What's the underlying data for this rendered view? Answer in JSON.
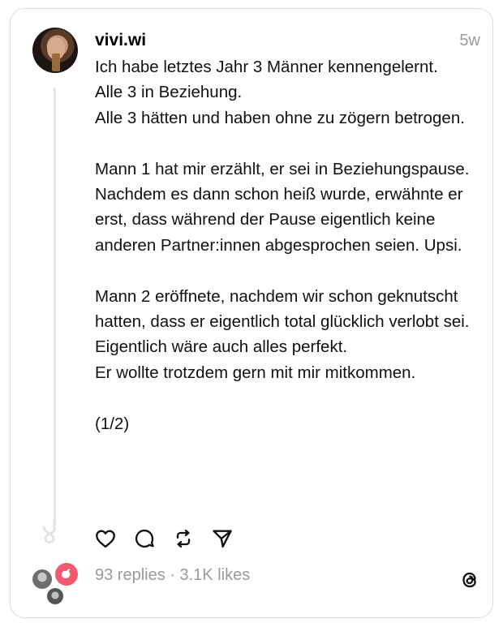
{
  "post": {
    "username": "vivi.wi",
    "time": "5w",
    "text": "Ich habe letztes Jahr 3 Männer kennengelernt.\nAlle 3 in Beziehung.\nAlle 3 hätten und haben ohne zu zögern betrogen.\n\nMann 1 hat mir erzählt, er sei in Beziehungspause. Nachdem es dann schon heiß wurde, erwähnte er erst, dass während der Pause eigentlich keine anderen Partner:innen abgesprochen seien. Upsi.\n\nMann 2 eröffnete, nachdem wir schon geknutscht hatten, dass er eigentlich total glücklich verlobt sei. Eigentlich wäre auch alles perfekt.\nEr wollte trotzdem gern mit mir mitkommen.\n\n(1/2)",
    "stats": "93 replies · 3.1K likes"
  },
  "actions": {
    "like_icon": "heart-icon",
    "reply_icon": "comment-icon",
    "repost_icon": "repost-icon",
    "share_icon": "send-icon"
  },
  "colors": {
    "text": "#111111",
    "muted": "#9a9a9a",
    "border": "#dcdcdc",
    "replier_accent": "#f05a6e"
  }
}
